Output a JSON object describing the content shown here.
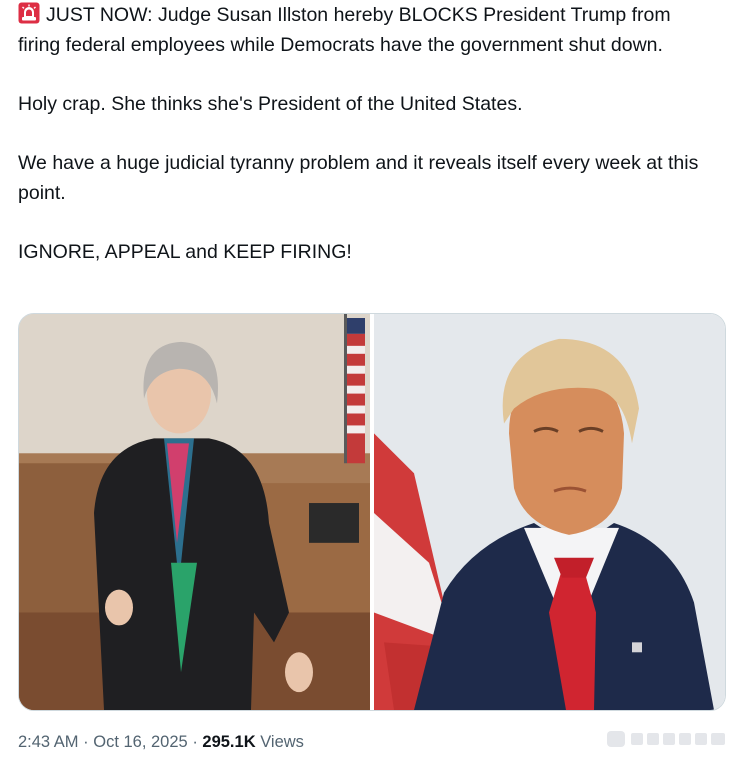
{
  "tweet": {
    "paragraphs": [
      "JUST NOW: Judge Susan Illston hereby BLOCKS President Trump from firing federal employees while Democrats have the government shut down.",
      "Holy crap. She thinks she's President of the United States.",
      "We have a huge judicial tyranny problem and it reveals itself every week at this point.",
      "IGNORE, APPEAL and KEEP FIRING!"
    ],
    "leading_emoji": "siren-icon"
  },
  "media": {
    "photos": [
      {
        "name": "photo-judge-in-courtroom"
      },
      {
        "name": "photo-president-portrait"
      }
    ]
  },
  "meta": {
    "time": "2:43 AM",
    "separator": "·",
    "date": "Oct 16, 2025",
    "views_count": "295.1K",
    "views_label": "Views"
  },
  "colors": {
    "text": "#0f1419",
    "secondary_text": "#536471",
    "border": "#cfd9de",
    "siren_red": "#e0245e"
  }
}
